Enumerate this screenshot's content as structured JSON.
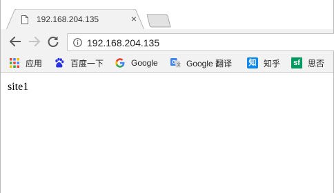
{
  "tab": {
    "title": "192.168.204.135",
    "favicon": "page-icon",
    "close_icon": "close-icon",
    "close_glyph": "×"
  },
  "toolbar": {
    "back_icon": "arrow-left-icon",
    "forward_icon": "arrow-right-icon",
    "reload_icon": "reload-icon",
    "url": "192.168.204.135",
    "info_icon": "info-icon"
  },
  "bookmarks": [
    {
      "label": "应用",
      "icon": "apps-grid-icon"
    },
    {
      "label": "百度一下",
      "icon": "baidu-paw-icon"
    },
    {
      "label": "Google",
      "icon": "google-g-icon"
    },
    {
      "label": "Google 翻译",
      "icon": "google-translate-icon"
    },
    {
      "label": "知乎",
      "icon": "zhihu-icon",
      "icon_text": "知"
    },
    {
      "label": "思否",
      "icon": "segmentfault-icon",
      "icon_text": "sf"
    }
  ],
  "page": {
    "body_text": "site1"
  },
  "colors": {
    "toolbar_bg": "#f2f2f2",
    "zhihu_blue": "#0f88eb",
    "sf_green": "#009a61",
    "baidu_blue": "#2932e1"
  }
}
